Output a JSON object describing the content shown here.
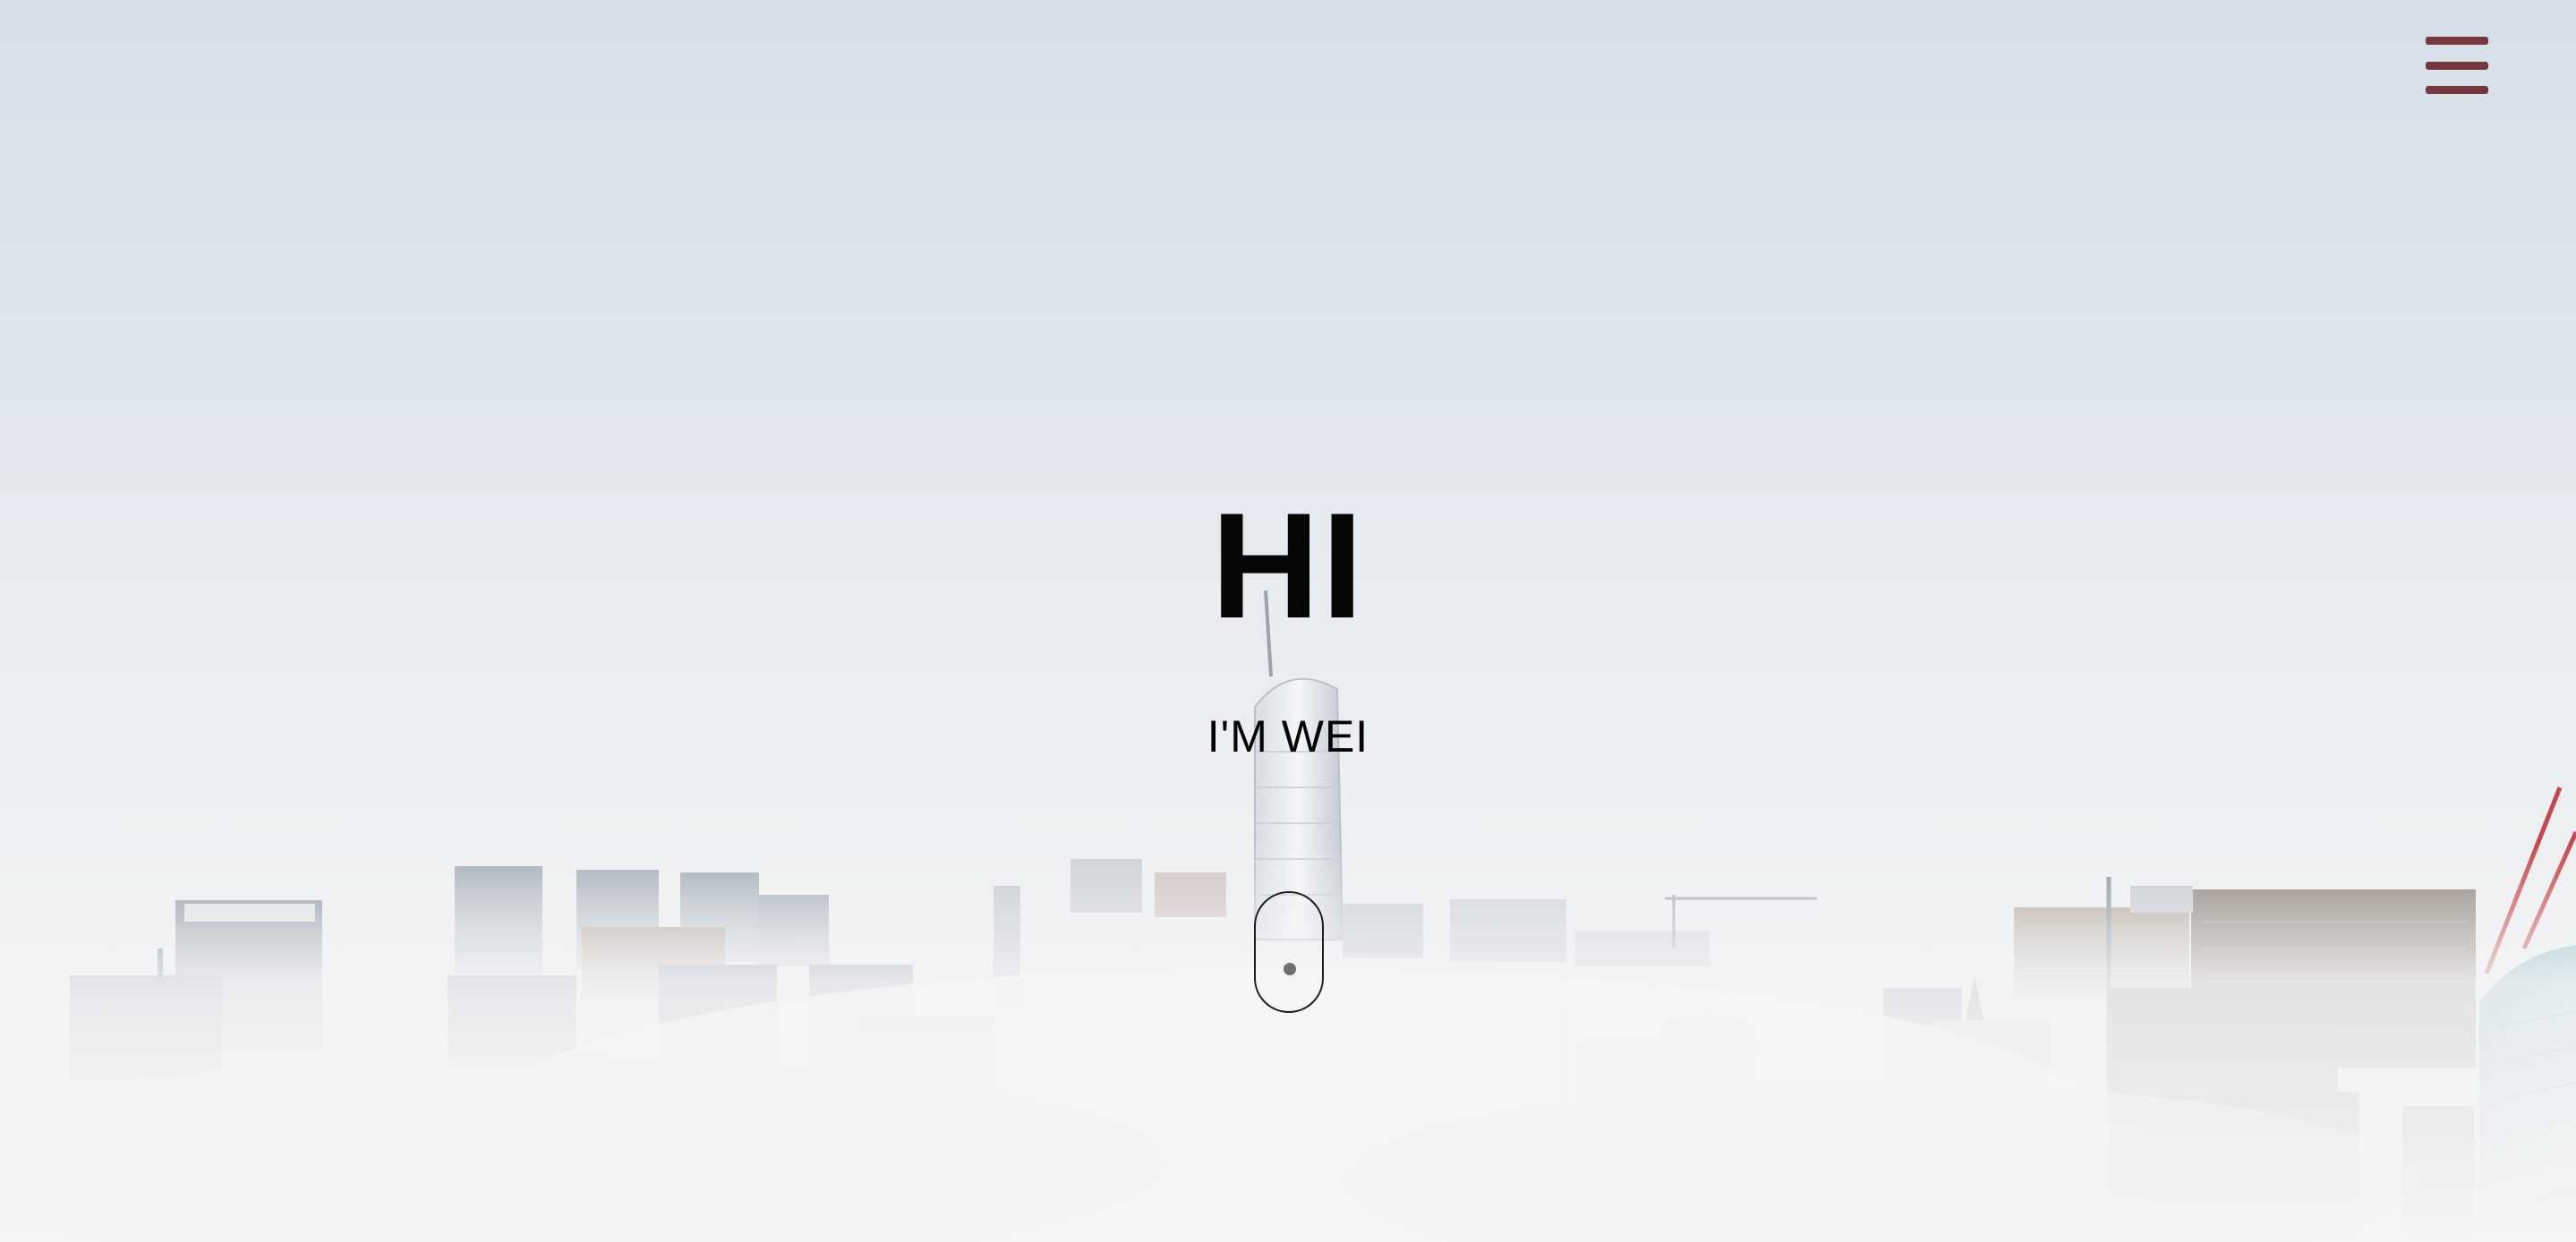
{
  "hero": {
    "title": "HI",
    "subtitle": "I'M WEI",
    "background_colors": {
      "sky_top": "#d6dfe8",
      "fog": "#f1f2f3"
    }
  },
  "nav": {
    "menu_icon": "hamburger-icon",
    "menu_color": "#74393e"
  },
  "scroll_indicator": {
    "icon": "mouse-scroll-icon"
  }
}
